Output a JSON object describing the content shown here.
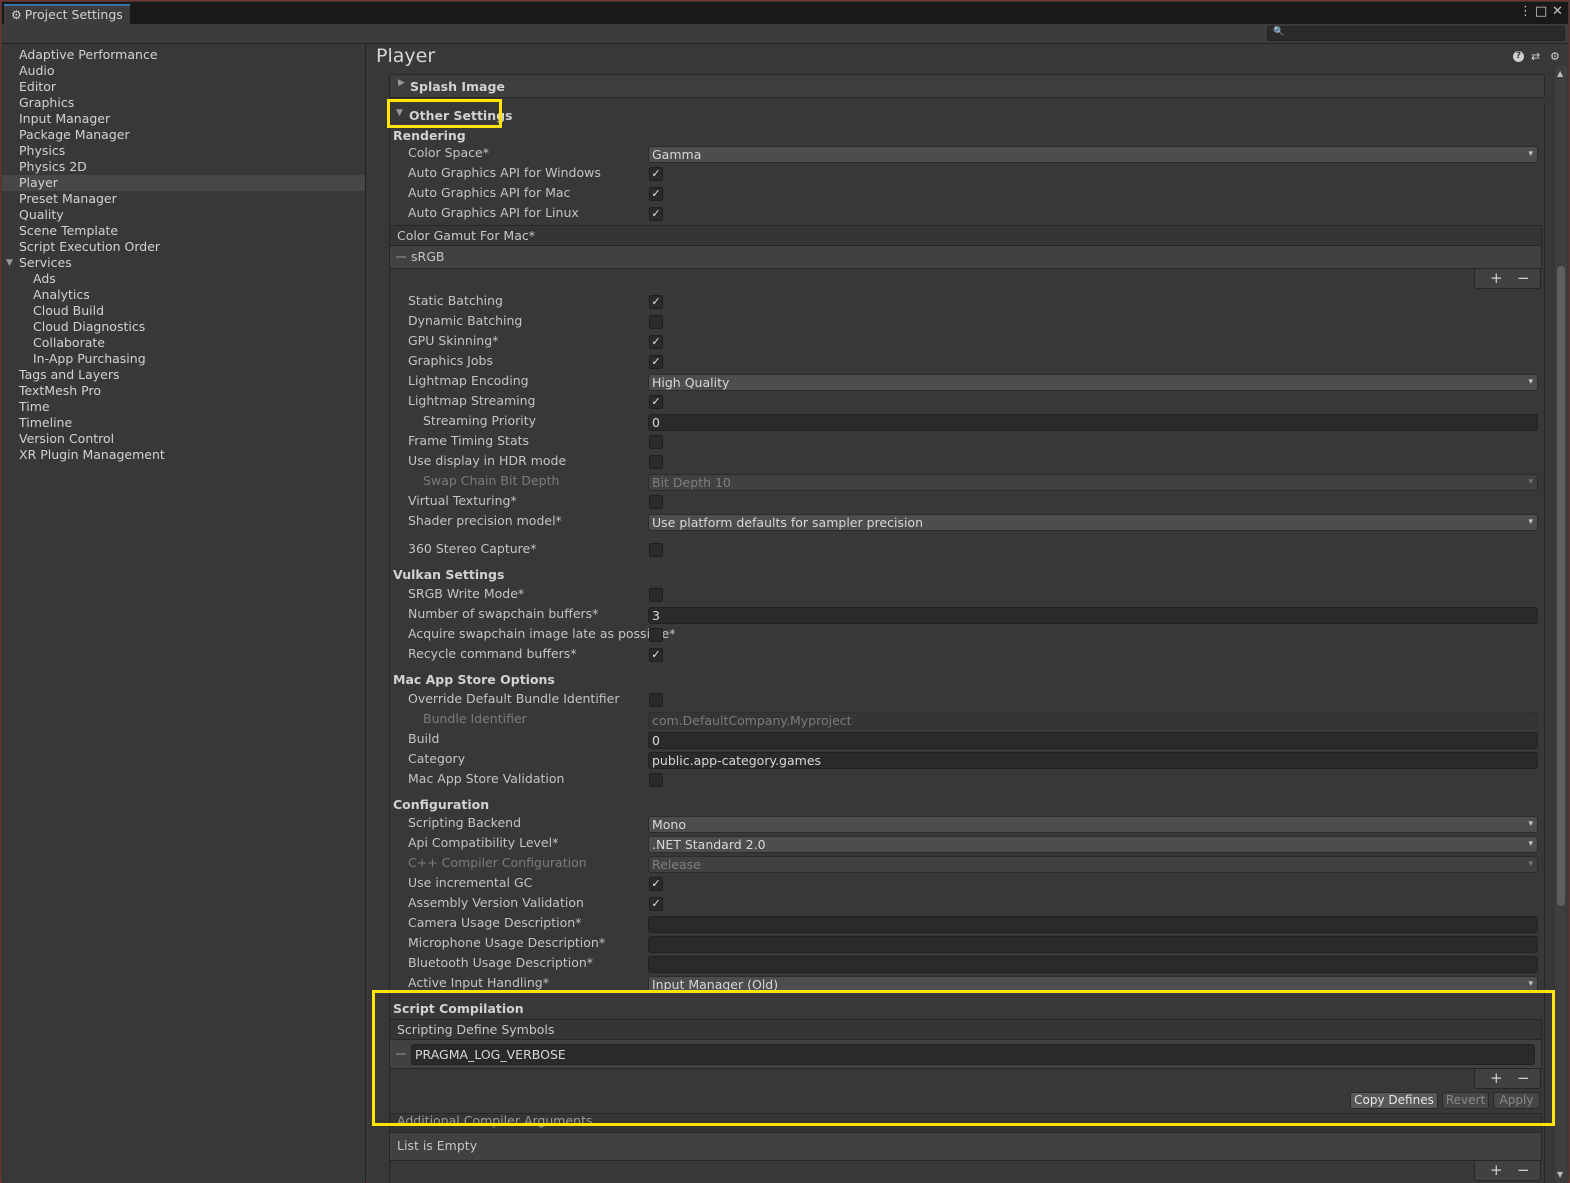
{
  "window": {
    "title": "Project Settings",
    "search_placeholder": ""
  },
  "sidebar": {
    "items": [
      {
        "label": "Adaptive Performance",
        "indent": 0,
        "selected": false
      },
      {
        "label": "Audio",
        "indent": 0,
        "selected": false
      },
      {
        "label": "Editor",
        "indent": 0,
        "selected": false
      },
      {
        "label": "Graphics",
        "indent": 0,
        "selected": false
      },
      {
        "label": "Input Manager",
        "indent": 0,
        "selected": false
      },
      {
        "label": "Package Manager",
        "indent": 0,
        "selected": false
      },
      {
        "label": "Physics",
        "indent": 0,
        "selected": false
      },
      {
        "label": "Physics 2D",
        "indent": 0,
        "selected": false
      },
      {
        "label": "Player",
        "indent": 0,
        "selected": true
      },
      {
        "label": "Preset Manager",
        "indent": 0,
        "selected": false
      },
      {
        "label": "Quality",
        "indent": 0,
        "selected": false
      },
      {
        "label": "Scene Template",
        "indent": 0,
        "selected": false
      },
      {
        "label": "Script Execution Order",
        "indent": 0,
        "selected": false
      },
      {
        "label": "Services",
        "indent": 0,
        "selected": false,
        "expanded": true
      },
      {
        "label": "Ads",
        "indent": 1,
        "selected": false
      },
      {
        "label": "Analytics",
        "indent": 1,
        "selected": false
      },
      {
        "label": "Cloud Build",
        "indent": 1,
        "selected": false
      },
      {
        "label": "Cloud Diagnostics",
        "indent": 1,
        "selected": false
      },
      {
        "label": "Collaborate",
        "indent": 1,
        "selected": false
      },
      {
        "label": "In-App Purchasing",
        "indent": 1,
        "selected": false
      },
      {
        "label": "Tags and Layers",
        "indent": 0,
        "selected": false
      },
      {
        "label": "TextMesh Pro",
        "indent": 0,
        "selected": false
      },
      {
        "label": "Time",
        "indent": 0,
        "selected": false
      },
      {
        "label": "Timeline",
        "indent": 0,
        "selected": false
      },
      {
        "label": "Version Control",
        "indent": 0,
        "selected": false
      },
      {
        "label": "XR Plugin Management",
        "indent": 0,
        "selected": false
      }
    ]
  },
  "main": {
    "title": "Player",
    "splash_label": "Splash Image",
    "other_label": "Other Settings",
    "rendering": {
      "header": "Rendering",
      "color_space_label": "Color Space*",
      "color_space": "Gamma",
      "auto_win_label": "Auto Graphics API  for Windows",
      "auto_mac_label": "Auto Graphics API  for Mac",
      "auto_linux_label": "Auto Graphics API  for Linux",
      "gamut_header": "Color Gamut For Mac*",
      "gamut_item": "sRGB",
      "static_batching_label": "Static Batching",
      "dynamic_batching_label": "Dynamic Batching",
      "gpu_skinning_label": "GPU Skinning*",
      "graphics_jobs_label": "Graphics Jobs",
      "lightmap_encoding_label": "Lightmap Encoding",
      "lightmap_encoding": "High Quality",
      "lightmap_streaming_label": "Lightmap Streaming",
      "streaming_priority_label": "Streaming Priority",
      "streaming_priority": "0",
      "frame_timing_label": "Frame Timing Stats",
      "hdr_label": "Use display in HDR mode",
      "swap_chain_label": "Swap Chain Bit Depth",
      "swap_chain": "Bit Depth 10",
      "virtual_texturing_label": "Virtual Texturing*",
      "shader_precision_label": "Shader precision model*",
      "shader_precision": "Use platform defaults for sampler precision",
      "stereo_label": "360 Stereo Capture*"
    },
    "vulkan": {
      "header": "Vulkan Settings",
      "srgb_label": "SRGB Write Mode*",
      "swapchain_buffers_label": "Number of swapchain buffers*",
      "swapchain_buffers": "3",
      "acquire_label": "Acquire swapchain image late as possible*",
      "recycle_label": "Recycle command buffers*"
    },
    "mac": {
      "header": "Mac App Store Options",
      "override_label": "Override Default Bundle Identifier",
      "bundle_label": "Bundle Identifier",
      "bundle": "com.DefaultCompany.Myproject",
      "build_label": "Build",
      "build": "0",
      "category_label": "Category",
      "category": "public.app-category.games",
      "validation_label": "Mac App Store Validation"
    },
    "config": {
      "header": "Configuration",
      "backend_label": "Scripting Backend",
      "backend": "Mono",
      "api_label": "Api Compatibility Level*",
      "api": ".NET Standard 2.0",
      "cpp_label": "C++ Compiler Configuration",
      "cpp": "Release",
      "gc_label": "Use incremental GC",
      "assembly_label": "Assembly Version Validation",
      "camera_label": "Camera Usage Description*",
      "camera": "",
      "mic_label": "Microphone Usage Description*",
      "mic": "",
      "bt_label": "Bluetooth Usage Description*",
      "bt": "",
      "input_label": "Active Input Handling*",
      "input": "Input Manager (Old)"
    },
    "script": {
      "header": "Script Compilation",
      "defines_header": "Scripting Define Symbols",
      "define_item": "PRAGMA_LOG_VERBOSE",
      "copy_label": "Copy Defines",
      "revert_label": "Revert",
      "apply_label": "Apply",
      "args_header": "Additional Compiler Arguments",
      "empty_label": "List is Empty"
    },
    "plus": "+",
    "minus": "−"
  },
  "icons": {
    "gear": "⚙",
    "help": "?",
    "presets": "⇄",
    "menu": "⋮",
    "maximize": "□",
    "close": "✕",
    "search": "🔍",
    "check": "✓",
    "caret": "▾",
    "fold_open": "▼",
    "fold_closed": "▶"
  },
  "colors": {
    "highlight": "#ffe500",
    "tab_accent": "#3a72b0",
    "selection": "#474747"
  }
}
